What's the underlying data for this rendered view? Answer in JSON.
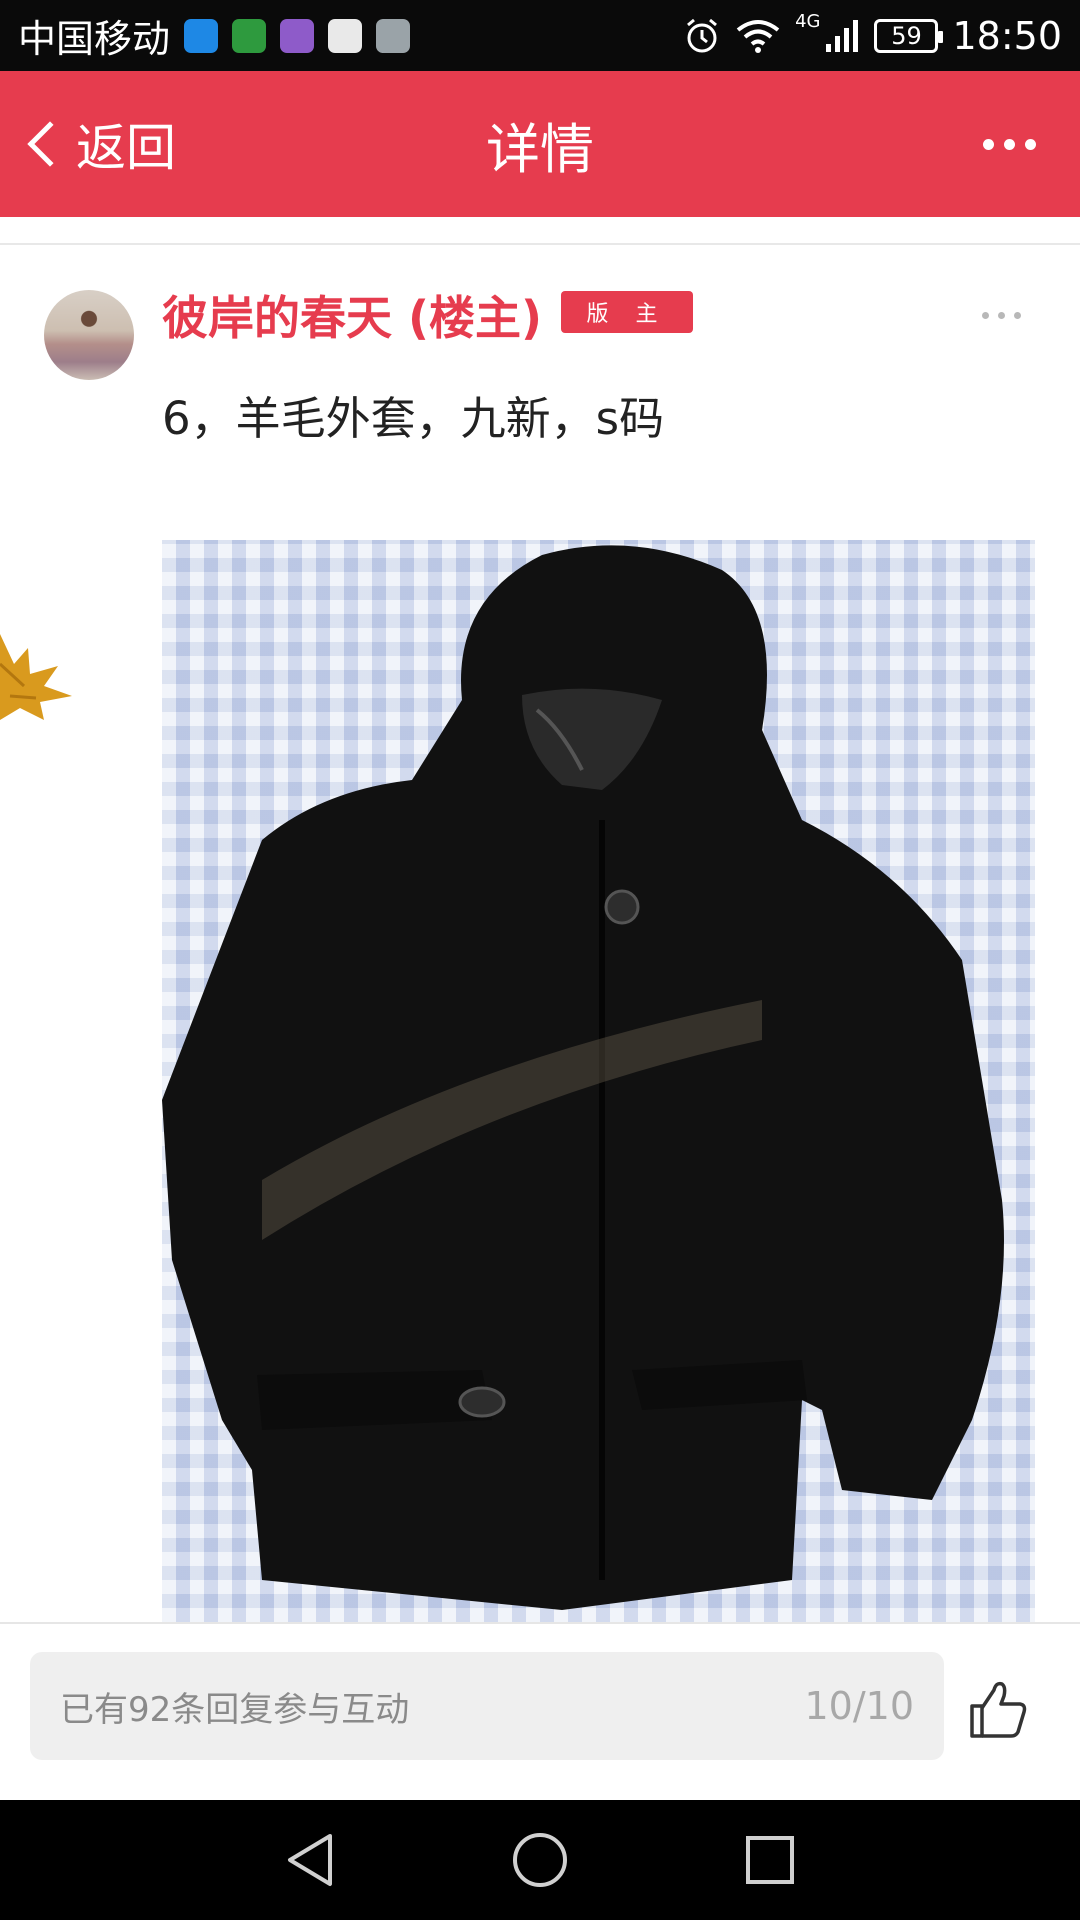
{
  "status_bar": {
    "carrier": "中国移动",
    "notification_icons": [
      "message-icon",
      "wechat-icon",
      "keyboard-icon",
      "map-icon",
      "gallery-icon"
    ],
    "network": "4G",
    "battery": "59",
    "time": "18:50"
  },
  "header": {
    "back_label": "返回",
    "title": "详情"
  },
  "post": {
    "author": "彼岸的春天 (楼主)",
    "badge": "版 主",
    "text": "6，羊毛外套，九新，s码",
    "image": "black-wool-hooded-jacket-photo"
  },
  "reply_bar": {
    "placeholder": "已有92条回复参与互动",
    "page_indicator": "10/10"
  },
  "colors": {
    "accent": "#e63c4e",
    "status_bar": "#0a0a0a",
    "reply_box": "#efefef"
  }
}
